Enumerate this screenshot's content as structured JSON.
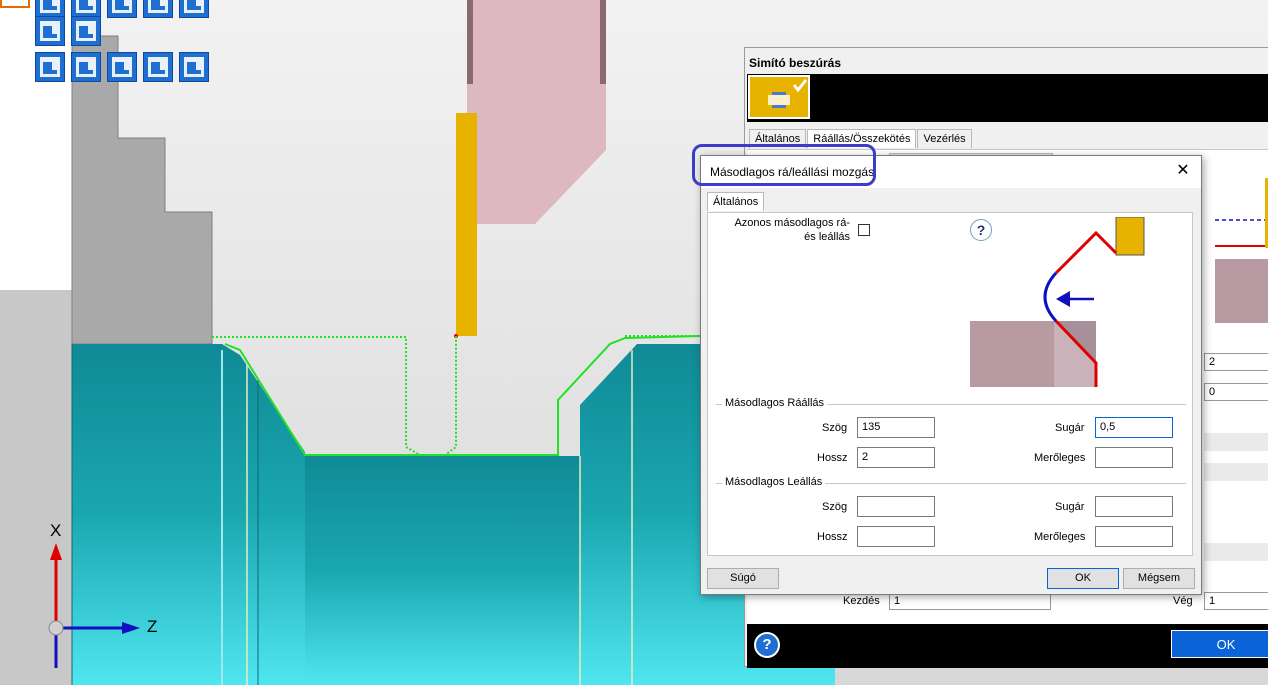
{
  "axes": {
    "x_label": "X",
    "z_label": "Z"
  },
  "background_dialog": {
    "title": "Simító beszúrás",
    "tabs": [
      "Általános",
      "Ráállás/Összekötés",
      "Vezérlés"
    ],
    "active_tab": 1,
    "field_right_1": "2",
    "field_right_2": "0",
    "kezdes_label": "Kezdés",
    "kezdes_value": "1",
    "veg_label": "Vég",
    "veg_value": "1",
    "help_symbol": "?",
    "ok_label": "OK"
  },
  "dialog": {
    "title": "Másodlagos rá/leállási mozgás",
    "close_symbol": "✕",
    "tab": "Általános",
    "same_checkbox_label": "Azonos másodlagos rá- és leállás",
    "same_checkbox_checked": false,
    "help_symbol": "?",
    "approach_group": {
      "title": "Másodlagos Ráállás",
      "angle_label": "Szög",
      "angle_value": "135",
      "radius_label": "Sugár",
      "radius_value": "0,5",
      "length_label": "Hossz",
      "length_value": "2",
      "perpendicular_label": "Merőleges",
      "perpendicular_value": ""
    },
    "retract_group": {
      "title": "Másodlagos Leállás",
      "angle_label": "Szög",
      "angle_value": "",
      "radius_label": "Sugár",
      "radius_value": "",
      "length_label": "Hossz",
      "length_value": "",
      "perpendicular_label": "Merőleges",
      "perpendicular_value": ""
    },
    "help_button": "Súgó",
    "ok_button": "OK",
    "cancel_button": "Mégsem"
  },
  "colors": {
    "part_teal": "#1aa7b0",
    "toolpath_green": "#22e022",
    "tool_yellow": "#e8b200",
    "accent_blue": "#0a64d8",
    "highlight": "#3c3cc8"
  }
}
